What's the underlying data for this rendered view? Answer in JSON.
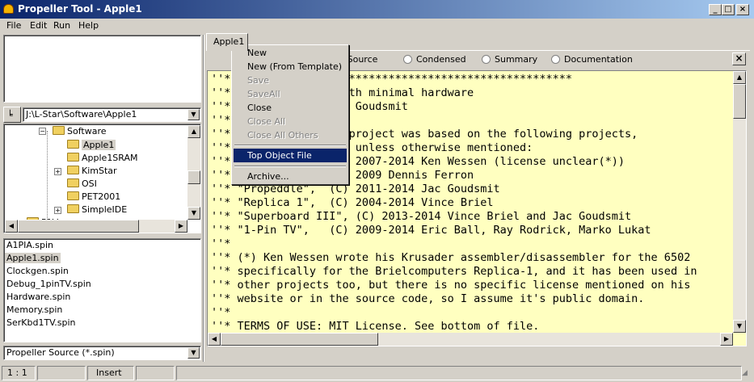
{
  "window": {
    "title": "Propeller Tool - Apple1"
  },
  "menu": [
    "File",
    "Edit",
    "Run",
    "Help"
  ],
  "path_combo": {
    "value": "J:\\L-Star\\Software\\Apple1"
  },
  "tree": {
    "items": [
      {
        "label": "Software",
        "expanded": true
      },
      {
        "label": "Apple1",
        "selected": true
      },
      {
        "label": "Apple1SRAM"
      },
      {
        "label": "KimStar",
        "collapsed": true
      },
      {
        "label": "OSI"
      },
      {
        "label": "PET2001"
      },
      {
        "label": "SimpleIDE",
        "collapsed": true
      },
      {
        "label": "P1V"
      }
    ]
  },
  "files": [
    "A1PIA.spin",
    "Apple1.spin",
    "Clockgen.spin",
    "Debug_1pinTV.spin",
    "Hardware.spin",
    "Memory.spin",
    "SerKbd1TV.spin"
  ],
  "selected_file": "Apple1.spin",
  "filter_combo": {
    "value": "Propeller Source (*.spin)"
  },
  "tab": {
    "label": "Apple1"
  },
  "view_modes": [
    {
      "label": "Full Source",
      "visible_label": "ll Source",
      "checked": true
    },
    {
      "label": "Condensed"
    },
    {
      "label": "Summary"
    },
    {
      "label": "Documentation"
    }
  ],
  "context_menu": [
    {
      "label": "New",
      "enabled": true
    },
    {
      "label": "New (From Template)",
      "enabled": true
    },
    {
      "label": "Save",
      "enabled": false
    },
    {
      "label": "SaveAll",
      "enabled": false
    },
    {
      "label": "Close",
      "enabled": true
    },
    {
      "label": "Close All",
      "enabled": false
    },
    {
      "label": "Close All Others",
      "enabled": false
    },
    {
      "separator": true
    },
    {
      "label": "Top Object File",
      "enabled": true,
      "highlighted": true
    },
    {
      "separator": true
    },
    {
      "label": "Archive...",
      "enabled": true
    }
  ],
  "code_lines": [
    "''*****************************************************",
    "''* Apple1 replica with minimal hardware              ",
    "''* (C) 2017-2018 Jac Goudsmit                        ",
    "''*",
    "''* The code in this project was based on the following projects,",
    "''* under MIT License unless otherwise mentioned:",
    "''* \"Krusader\",   (C) 2007-2014 Ken Wessen (license unclear(*))",
    "''* \"PropTerm\",   (C) 2009 Dennis Ferron",
    "''* \"Propeddle\",  (C) 2011-2014 Jac Goudsmit",
    "''* \"Replica 1\",  (C) 2004-2014 Vince Briel",
    "''* \"Superboard III\", (C) 2013-2014 Vince Briel and Jac Goudsmit",
    "''* \"1-Pin TV\",   (C) 2009-2014 Eric Ball, Ray Rodrick, Marko Lukat",
    "''*",
    "''* (*) Ken Wessen wrote his Krusader assembler/disassembler for the 6502",
    "''* specifically for the Brielcomputers Replica-1, and it has been used in",
    "''* other projects too, but there is no specific license mentioned on his",
    "''* website or in the source code, so I assume it's public domain.",
    "''*",
    "''* TERMS OF USE: MIT License. See bottom of file.",
    "''*****************************************************"
  ],
  "status": {
    "position": "1 : 1",
    "mode": "Insert"
  }
}
